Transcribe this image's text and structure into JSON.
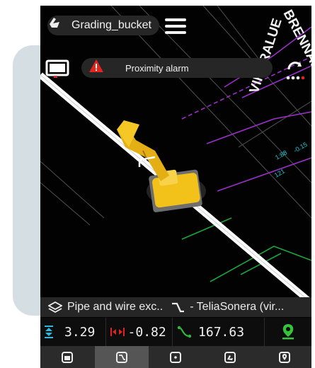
{
  "machine": {
    "tool_name": "Grading_bucket",
    "bucket_icon": "bucket-icon"
  },
  "alarm": {
    "label": "Proximity alarm",
    "icon": "warning-triangle-icon",
    "icon_color": "#e0261f"
  },
  "map": {
    "street_labels": [
      "VIHERALUE",
      "BRENNAR"
    ],
    "contour_labels": [
      "121",
      "-0.15",
      "1:88"
    ],
    "colors": {
      "pipe": "#ffffff",
      "excavator": "#f2c21b",
      "contours": "#9b2fc9",
      "green_lines": "#19a53a",
      "labels": "#1fc8d8"
    }
  },
  "info_bar": {
    "layer_label": "Pipe and wire exc..",
    "line_label": "- TeliaSonera (vir..."
  },
  "measurements": [
    {
      "icon": "vertical-distance-icon",
      "icon_color": "#2fb8e0",
      "value": "3.29"
    },
    {
      "icon": "horizontal-distance-icon",
      "icon_color": "#e02424",
      "value": "-0.82"
    },
    {
      "icon": "station-icon",
      "icon_color": "#35b63a",
      "value": "167.63"
    }
  ],
  "location_icon": {
    "icon": "location-pin-icon",
    "color": "#35c43a"
  },
  "tabs": [
    {
      "name": "tab-machine-view",
      "icon": "machine-view-icon",
      "active": false
    },
    {
      "name": "tab-profile",
      "icon": "profile-icon",
      "active": true
    },
    {
      "name": "tab-point",
      "icon": "point-icon",
      "active": false
    },
    {
      "name": "tab-bucket",
      "icon": "bucket-tab-icon",
      "active": false
    },
    {
      "name": "tab-location",
      "icon": "location-tab-icon",
      "active": false
    }
  ]
}
